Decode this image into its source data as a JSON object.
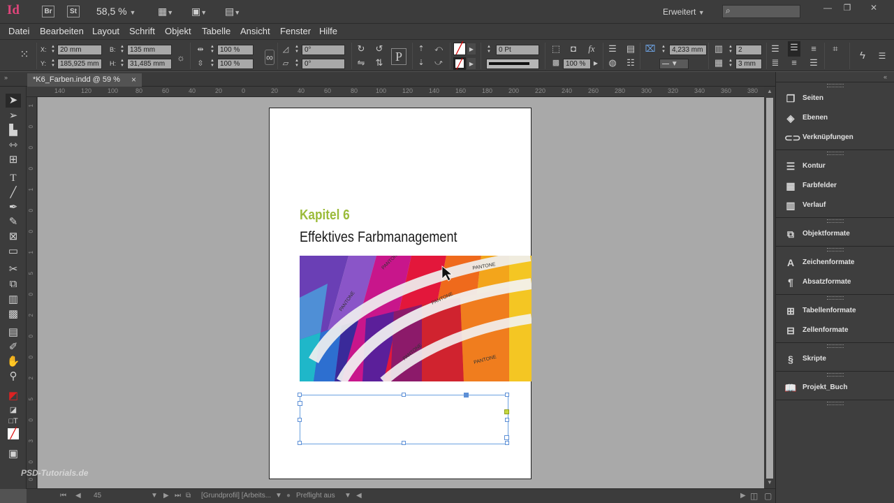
{
  "app": {
    "logo": "Id",
    "bridge_label": "Br",
    "stock_label": "St",
    "zoom": "58,5 %",
    "workspace": "Erweitert",
    "window_buttons": [
      "—",
      "❐",
      "✕"
    ]
  },
  "menu": [
    "Datei",
    "Bearbeiten",
    "Layout",
    "Schrift",
    "Objekt",
    "Tabelle",
    "Ansicht",
    "Fenster",
    "Hilfe"
  ],
  "control": {
    "x_label": "X:",
    "x_value": "20 mm",
    "y_label": "Y:",
    "y_value": "185,925 mm",
    "w_label": "B:",
    "w_value": "135 mm",
    "h_label": "H:",
    "h_value": "31,485 mm",
    "scale_x": "100 %",
    "scale_y": "100 %",
    "rotation": "0°",
    "shear": "0°",
    "stroke_weight": "0 Pt",
    "opacity": "100 %",
    "inset": "4,233 mm",
    "columns": "2",
    "gutter": "3 mm"
  },
  "tab": {
    "title": "*K6_Farben.indd @ 59 %",
    "close": "×"
  },
  "ruler": {
    "top": [
      "140",
      "120",
      "100",
      "80",
      "60",
      "40",
      "20",
      "0",
      "20",
      "40",
      "60",
      "80",
      "100",
      "120",
      "140",
      "160",
      "180",
      "200",
      "220",
      "240",
      "260",
      "280",
      "300",
      "320",
      "340",
      "360",
      "380"
    ],
    "left": [
      "1",
      "0",
      "0",
      "0",
      "1",
      "0",
      "0",
      "1",
      "5",
      "0",
      "2",
      "0",
      "0",
      "2",
      "5",
      "0",
      "3",
      "0",
      "0"
    ]
  },
  "document": {
    "chapter": "Kapitel 6",
    "title": "Effektives Farbmanagement"
  },
  "status": {
    "page": "45",
    "profile": "[Grundprofil] [Arbeits...",
    "preflight": "Preflight aus"
  },
  "panels": [
    {
      "label": "Seiten",
      "icon": "pages-icon"
    },
    {
      "label": "Ebenen",
      "icon": "layers-icon"
    },
    {
      "label": "Verknüpfungen",
      "icon": "links-icon"
    },
    {
      "label": "Kontur",
      "icon": "stroke-icon"
    },
    {
      "label": "Farbfelder",
      "icon": "swatches-icon"
    },
    {
      "label": "Verlauf",
      "icon": "gradient-icon"
    },
    {
      "label": "Objektformate",
      "icon": "object-styles-icon"
    },
    {
      "label": "Zeichenformate",
      "icon": "character-styles-icon"
    },
    {
      "label": "Absatzformate",
      "icon": "paragraph-styles-icon"
    },
    {
      "label": "Tabellenformate",
      "icon": "table-styles-icon"
    },
    {
      "label": "Zellenformate",
      "icon": "cell-styles-icon"
    },
    {
      "label": "Skripte",
      "icon": "scripts-icon"
    },
    {
      "label": "Projekt_Buch",
      "icon": "book-icon"
    }
  ],
  "photo": {
    "swatch_labels": [
      "PANTONE",
      "PANTONE",
      "PANTONE",
      "PANTONE",
      "PANTONE",
      "PANTONE"
    ]
  },
  "watermark": "PSD-Tutorials.de",
  "colors": {
    "accent_chapter": "#9bbb3a",
    "selection": "#5c8fd6"
  }
}
